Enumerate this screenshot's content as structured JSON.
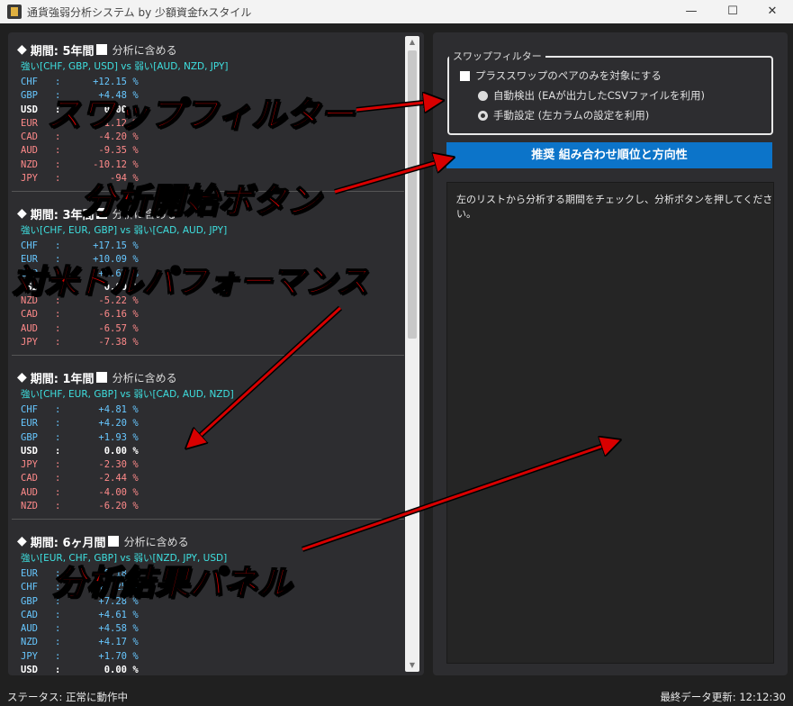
{
  "window": {
    "title": "通貨強弱分析システム by 少額資金fxスタイル",
    "min": "—",
    "max": "☐",
    "close": "✕"
  },
  "left": {
    "diamond": "◆",
    "include_label": "分析に含める",
    "sections": [
      {
        "period": "期間: 5年間",
        "summary": "強い[CHF, GBP, USD] vs 弱い[AUD, NZD, JPY]",
        "rows": [
          {
            "cur": "CHF",
            "val": "+12.15",
            "pct": "%",
            "sign": "pos"
          },
          {
            "cur": "GBP",
            "val": "+4.48",
            "pct": "%",
            "sign": "pos"
          },
          {
            "cur": "USD",
            "val": "0.00",
            "pct": "%",
            "sign": "zero"
          },
          {
            "cur": "EUR",
            "val": "-1.12",
            "pct": "%",
            "sign": "neg"
          },
          {
            "cur": "CAD",
            "val": "-4.20",
            "pct": "%",
            "sign": "neg"
          },
          {
            "cur": "AUD",
            "val": "-9.35",
            "pct": "%",
            "sign": "neg"
          },
          {
            "cur": "NZD",
            "val": "-10.12",
            "pct": "%",
            "sign": "neg"
          },
          {
            "cur": "JPY",
            "val": "-94",
            "pct": "%",
            "sign": "neg"
          }
        ]
      },
      {
        "period": "期間: 3年間",
        "summary": "強い[CHF, EUR, GBP] vs 弱い[CAD, AUD, JPY]",
        "rows": [
          {
            "cur": "CHF",
            "val": "+17.15",
            "pct": "%",
            "sign": "pos"
          },
          {
            "cur": "EUR",
            "val": "+10.09",
            "pct": "%",
            "sign": "pos"
          },
          {
            "cur": "GBP",
            "val": "+1.62",
            "pct": "%",
            "sign": "pos"
          },
          {
            "cur": "USD",
            "val": "0.00",
            "pct": "%",
            "sign": "zero"
          },
          {
            "cur": "NZD",
            "val": "-5.22",
            "pct": "%",
            "sign": "neg"
          },
          {
            "cur": "CAD",
            "val": "-6.16",
            "pct": "%",
            "sign": "neg"
          },
          {
            "cur": "AUD",
            "val": "-6.57",
            "pct": "%",
            "sign": "neg"
          },
          {
            "cur": "JPY",
            "val": "-7.38",
            "pct": "%",
            "sign": "neg"
          }
        ]
      },
      {
        "period": "期間: 1年間",
        "summary": "強い[CHF, EUR, GBP] vs 弱い[CAD, AUD, NZD]",
        "rows": [
          {
            "cur": "CHF",
            "val": "+4.81",
            "pct": "%",
            "sign": "pos"
          },
          {
            "cur": "EUR",
            "val": "+4.20",
            "pct": "%",
            "sign": "pos"
          },
          {
            "cur": "GBP",
            "val": "+1.93",
            "pct": "%",
            "sign": "pos"
          },
          {
            "cur": "USD",
            "val": "0.00",
            "pct": "%",
            "sign": "zero"
          },
          {
            "cur": "JPY",
            "val": "-2.30",
            "pct": "%",
            "sign": "neg"
          },
          {
            "cur": "CAD",
            "val": "-2.44",
            "pct": "%",
            "sign": "neg"
          },
          {
            "cur": "AUD",
            "val": "-4.00",
            "pct": "%",
            "sign": "neg"
          },
          {
            "cur": "NZD",
            "val": "-6.20",
            "pct": "%",
            "sign": "neg"
          }
        ]
      },
      {
        "period": "期間: 6ヶ月間",
        "summary": "強い[EUR, CHF, GBP] vs 弱い[NZD, JPY, USD]",
        "rows": [
          {
            "cur": "EUR",
            "val": "+9.18",
            "pct": "%",
            "sign": "pos"
          },
          {
            "cur": "CHF",
            "val": "+8.25",
            "pct": "%",
            "sign": "pos"
          },
          {
            "cur": "GBP",
            "val": "+7.28",
            "pct": "%",
            "sign": "pos"
          },
          {
            "cur": "CAD",
            "val": "+4.61",
            "pct": "%",
            "sign": "pos"
          },
          {
            "cur": "AUD",
            "val": "+4.58",
            "pct": "%",
            "sign": "pos"
          },
          {
            "cur": "NZD",
            "val": "+4.17",
            "pct": "%",
            "sign": "pos"
          },
          {
            "cur": "JPY",
            "val": "+1.70",
            "pct": "%",
            "sign": "pos"
          },
          {
            "cur": "USD",
            "val": "0.00",
            "pct": "%",
            "sign": "zero"
          }
        ]
      }
    ]
  },
  "right": {
    "filter_legend": "スワップフィルター",
    "plus_swap_only": "プラススワップのペアのみを対象にする",
    "auto_detect": "自動検出 (EAが出力したCSVファイルを利用)",
    "manual": "手動設定 (左カラムの設定を利用)",
    "analyze_button": "推奨 組み合わせ順位と方向性",
    "result_text": "左のリストから分析する期間をチェックし、分析ボタンを押してください。"
  },
  "status": {
    "left": "ステータス: 正常に動作中",
    "right": "最終データ更新: 12:12:30"
  },
  "annotations": {
    "swap_filter": "スワップフィルター",
    "analyze_start": "分析開始ボタン",
    "usd_performance": "対米ドルパフォーマンス",
    "result_panel": "分析結果パネル"
  }
}
